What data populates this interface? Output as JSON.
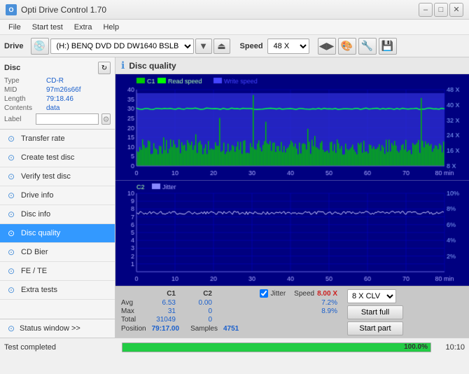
{
  "titlebar": {
    "title": "Opti Drive Control 1.70",
    "minimize": "–",
    "maximize": "□",
    "close": "✕"
  },
  "menubar": {
    "items": [
      "File",
      "Start test",
      "Extra",
      "Help"
    ]
  },
  "drivebar": {
    "label": "Drive",
    "drive_value": "(H:)  BENQ DVD DD DW1640 BSLB",
    "speed_label": "Speed",
    "speed_value": "48 X"
  },
  "disc": {
    "title": "Disc",
    "type_label": "Type",
    "type_value": "CD-R",
    "mid_label": "MID",
    "mid_value": "97m26s66f",
    "length_label": "Length",
    "length_value": "79:18.46",
    "contents_label": "Contents",
    "contents_value": "data",
    "label_label": "Label",
    "label_value": ""
  },
  "sidebar": {
    "items": [
      {
        "id": "transfer-rate",
        "label": "Transfer rate"
      },
      {
        "id": "create-test-disc",
        "label": "Create test disc"
      },
      {
        "id": "verify-test-disc",
        "label": "Verify test disc"
      },
      {
        "id": "drive-info",
        "label": "Drive info"
      },
      {
        "id": "disc-info",
        "label": "Disc info"
      },
      {
        "id": "disc-quality",
        "label": "Disc quality",
        "active": true
      },
      {
        "id": "cd-bier",
        "label": "CD Bier"
      },
      {
        "id": "fe-te",
        "label": "FE / TE"
      },
      {
        "id": "extra-tests",
        "label": "Extra tests"
      }
    ],
    "status_window": "Status window >>"
  },
  "disc_quality": {
    "title": "Disc quality",
    "chart1": {
      "title": "C1",
      "legend": [
        "C1",
        "Read speed",
        "Write speed"
      ],
      "y_max": 40,
      "y_labels": [
        "40",
        "35-",
        "30-",
        "25-",
        "20-",
        "15-",
        "10-",
        "5-"
      ],
      "x_labels": [
        "0",
        "10",
        "20",
        "30",
        "40",
        "50",
        "60",
        "70",
        "80 min"
      ],
      "right_labels": [
        "48 X",
        "40 X",
        "32 X",
        "24 X",
        "16 X",
        "8 X"
      ],
      "secondary_y_unit": "X"
    },
    "chart2": {
      "title": "C2",
      "legend": [
        "Jitter"
      ],
      "y_labels": [
        "10-",
        "9-",
        "8-",
        "7-",
        "6-",
        "5-",
        "4-",
        "3-",
        "2-",
        "1-"
      ],
      "x_labels": [
        "0",
        "10",
        "20",
        "30",
        "40",
        "50",
        "60",
        "70",
        "80 min"
      ],
      "right_labels": [
        "10%",
        "8%",
        "6%",
        "4%",
        "2%"
      ]
    }
  },
  "stats": {
    "headers": [
      "C1",
      "C2",
      "",
      "Jitter",
      "Speed"
    ],
    "avg_label": "Avg",
    "max_label": "Max",
    "total_label": "Total",
    "c1_avg": "6.53",
    "c1_max": "31",
    "c1_total": "31049",
    "c2_avg": "0.00",
    "c2_max": "0",
    "c2_total": "0",
    "jitter_checked": true,
    "jitter_avg": "7.2%",
    "jitter_max": "8.9%",
    "speed_value": "8.00 X",
    "speed_clv": "8 X CLV",
    "position_label": "Position",
    "position_value": "79:17.00",
    "samples_label": "Samples",
    "samples_value": "4751",
    "start_full_label": "Start full",
    "start_part_label": "Start part"
  },
  "statusbar": {
    "text": "Test completed",
    "progress": 100,
    "progress_text": "100.0%",
    "time": "10:10"
  }
}
